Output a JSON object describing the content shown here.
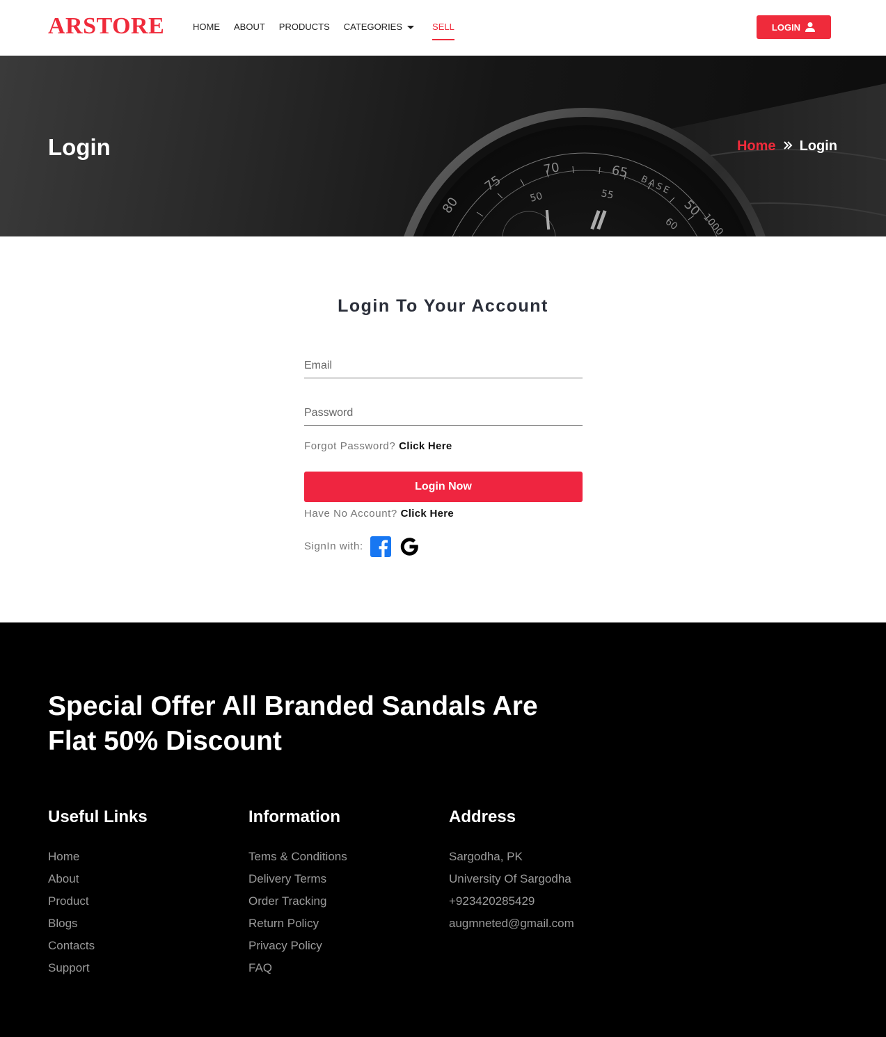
{
  "header": {
    "logo": "ARSTORE",
    "nav": [
      {
        "label": "HOME"
      },
      {
        "label": "ABOUT"
      },
      {
        "label": "PRODUCTS"
      },
      {
        "label": "CATEGORIES"
      },
      {
        "label": "SELL"
      }
    ],
    "active_nav": "SELL",
    "login_label": "LOGIN",
    "accent_color": "#ef2b3b"
  },
  "banner": {
    "title": "Login",
    "breadcrumb_home": "Home",
    "breadcrumb_current": "Login",
    "breadcrumb_separator_icon": "double-chevron-right-icon",
    "watch_dial_numbers": [
      "80",
      "75",
      "70",
      "65",
      "50",
      "55",
      "60",
      "50",
      "1000"
    ],
    "watch_dial_label": "BASE"
  },
  "login_form": {
    "title": "Login To Your Account",
    "email_placeholder": "Email",
    "password_placeholder": "Password",
    "forgot_text": "Forgot Password?",
    "forgot_link": "Click Here",
    "submit_label": "Login Now",
    "no_account_text": "Have No Account?",
    "no_account_link": "Click Here",
    "signin_with": "SignIn with:",
    "social_icons": [
      "facebook-icon",
      "google-icon"
    ]
  },
  "footer": {
    "promo": "Special Offer All Branded Sandals Are Flat 50% Discount",
    "useful_links": {
      "title": "Useful Links",
      "items": [
        "Home",
        "About",
        "Product",
        "Blogs",
        "Contacts",
        "Support"
      ]
    },
    "information": {
      "title": "Information",
      "items": [
        "Tems & Conditions",
        "Delivery Terms",
        "Order Tracking",
        "Return Policy",
        "Privacy Policy",
        "FAQ"
      ]
    },
    "address": {
      "title": "Address",
      "items": [
        "Sargodha, PK",
        "University Of Sargodha",
        "+923420285429",
        "augmneted@gmail.com"
      ]
    }
  }
}
